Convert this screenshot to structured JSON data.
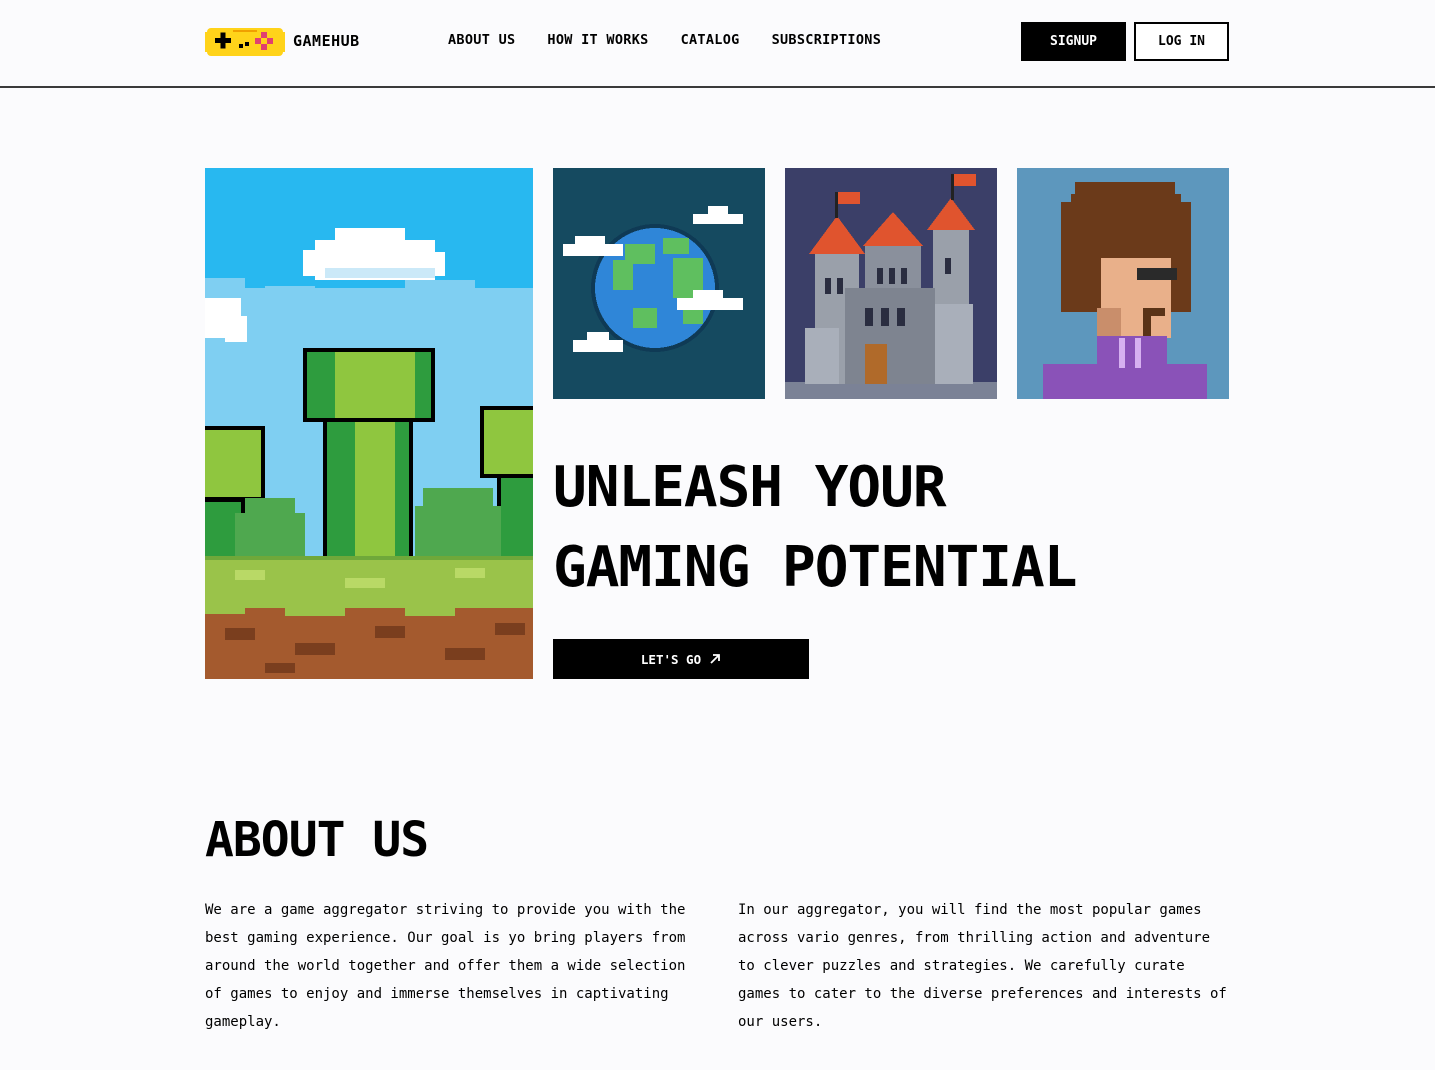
{
  "brand": {
    "name": "GAMEHUB"
  },
  "nav": {
    "items": [
      {
        "label": "ABOUT US"
      },
      {
        "label": "HOW IT WORKS"
      },
      {
        "label": "CATALOG"
      },
      {
        "label": "SUBSCRIPTIONS"
      }
    ]
  },
  "auth": {
    "signup_label": "SIGNUP",
    "login_label": "LOG IN"
  },
  "hero": {
    "title_line1": "UNLEASH YOUR",
    "title_line2": "GAMING POTENTIAL",
    "cta_label": "LET'S GO",
    "cta_icon": "arrow-up-right-icon"
  },
  "about": {
    "title": "ABOUT US",
    "paragraph1": "We are a game aggregator striving to provide you with the best gaming experience. Our goal is yo bring players from around the world together and offer them a wide selection of games to enjoy and immerse themselves in captivating gameplay.",
    "paragraph2": "In our aggregator, you will find the most popular games across vario genres, from thrilling action and adventure to clever puzzles and strategies. We carefully curate games to cater to the diverse preferences and interests of our users."
  },
  "colors": {
    "accent": "#000000",
    "background": "#fbfbfd",
    "logo_yellow": "#ffd31a"
  }
}
